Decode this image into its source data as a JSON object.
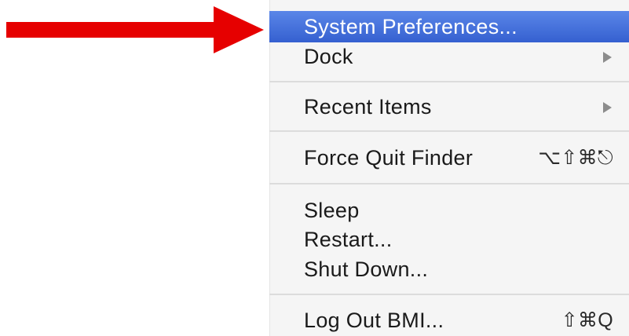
{
  "annotation": {
    "arrow_color": "#e60000"
  },
  "menu": {
    "highlight_color": "#3f6ddb",
    "items": [
      {
        "label": "System Preferences...",
        "shortcut": "",
        "submenu": false,
        "highlighted": true
      },
      {
        "label": "Dock",
        "shortcut": "",
        "submenu": true,
        "highlighted": false
      },
      {
        "label": "Recent Items",
        "shortcut": "",
        "submenu": true,
        "highlighted": false
      },
      {
        "label": "Force Quit Finder",
        "shortcut": "⌥⇧⌘⎋",
        "submenu": false,
        "highlighted": false
      },
      {
        "label": "Sleep",
        "shortcut": "",
        "submenu": false,
        "highlighted": false
      },
      {
        "label": "Restart...",
        "shortcut": "",
        "submenu": false,
        "highlighted": false
      },
      {
        "label": "Shut Down...",
        "shortcut": "",
        "submenu": false,
        "highlighted": false
      },
      {
        "label": "Log Out BMI...",
        "shortcut": "⇧⌘Q",
        "submenu": false,
        "highlighted": false
      }
    ]
  }
}
